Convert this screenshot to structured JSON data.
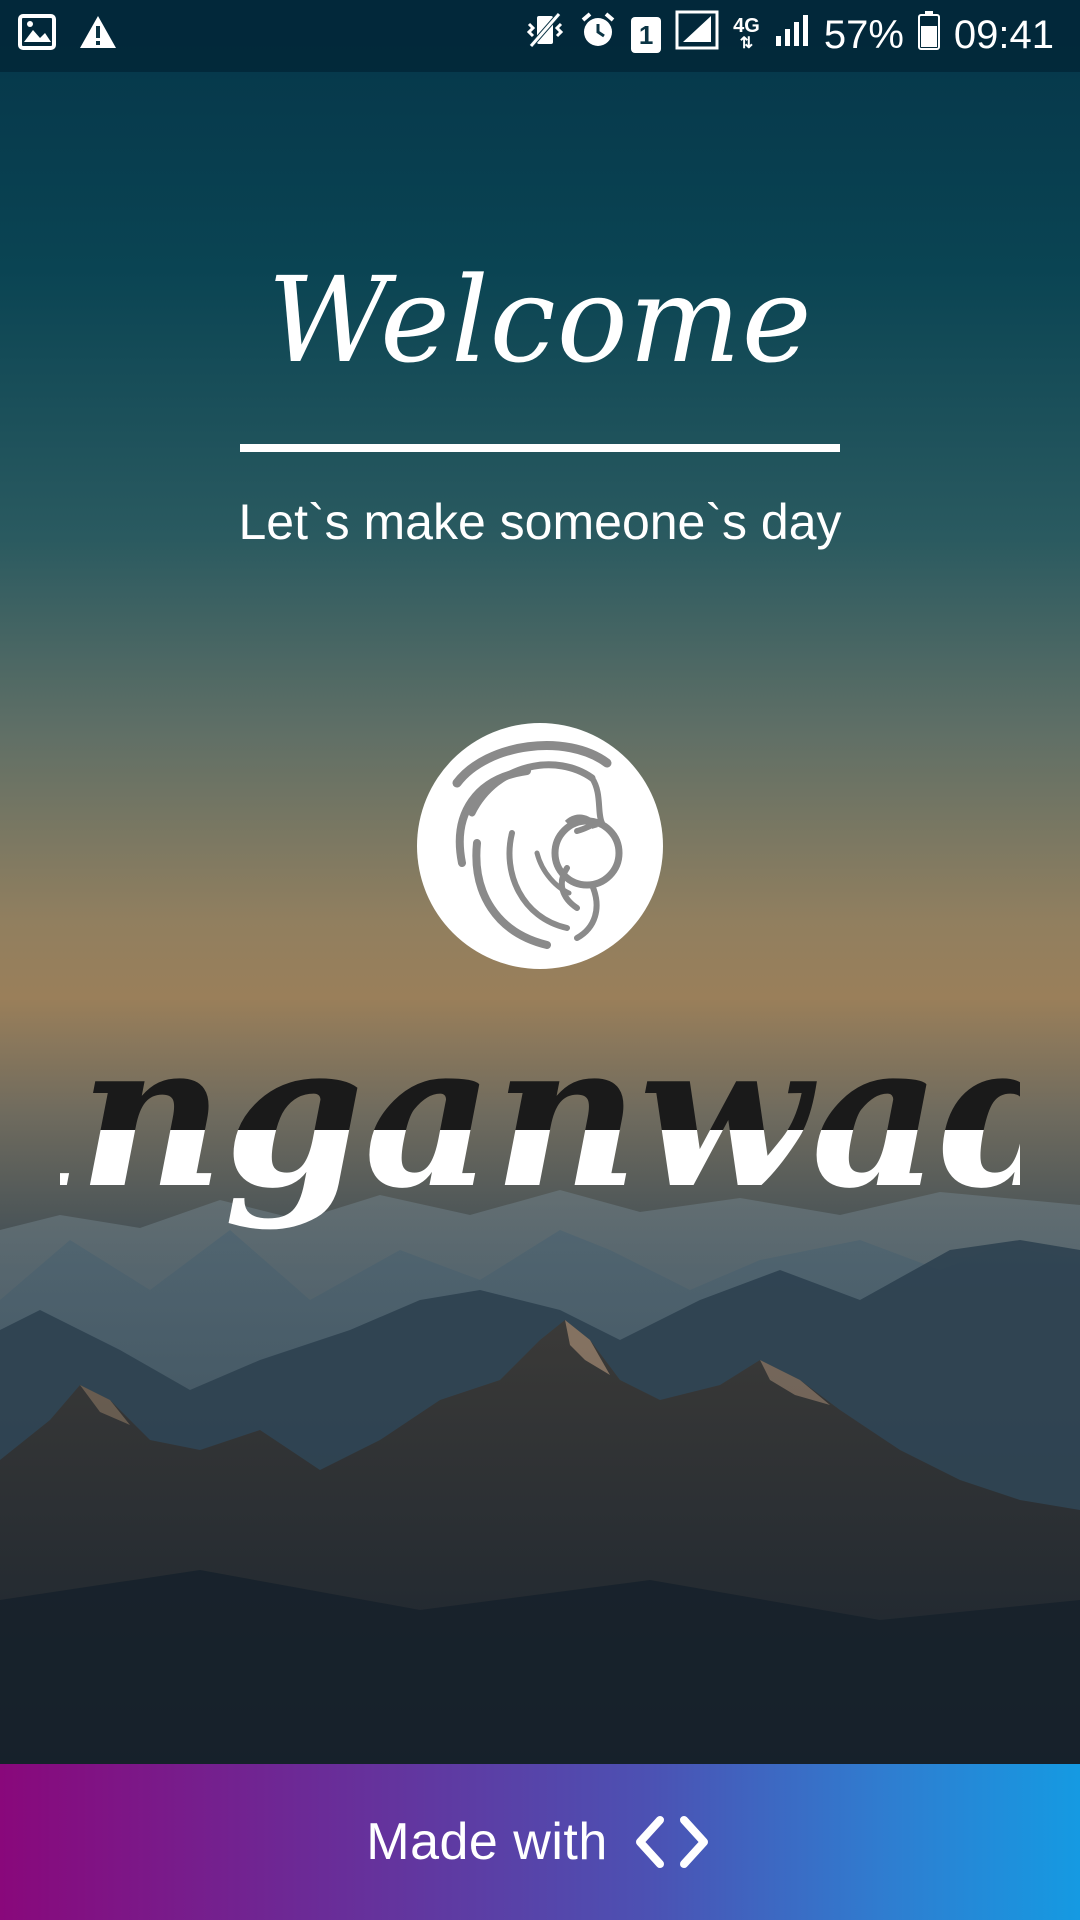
{
  "status_bar": {
    "icons_left": [
      "image-icon",
      "warning-icon"
    ],
    "icons_right": [
      "vibrate-mute-icon",
      "alarm-icon",
      "sim-icon",
      "signal-icon",
      "network-4g-icon",
      "signal-icon-2",
      "battery-icon"
    ],
    "sim_slot": "1",
    "network_type": "4G",
    "battery": "57%",
    "time": "09:41"
  },
  "welcome": {
    "title": "Welcome",
    "tagline": "Let`s make someone`s day"
  },
  "logo": {
    "icon": "mother-baby-icon"
  },
  "app": {
    "name": "Anganwadi"
  },
  "footer": {
    "text": "Made with",
    "icon": "code-brackets-icon"
  },
  "colors": {
    "footer_gradient_start": "#89087b",
    "footer_gradient_end": "#159ae2",
    "logo_gray": "#8a8a8a",
    "app_name_dark": "#1a1a1a",
    "app_name_light": "#ffffff"
  }
}
